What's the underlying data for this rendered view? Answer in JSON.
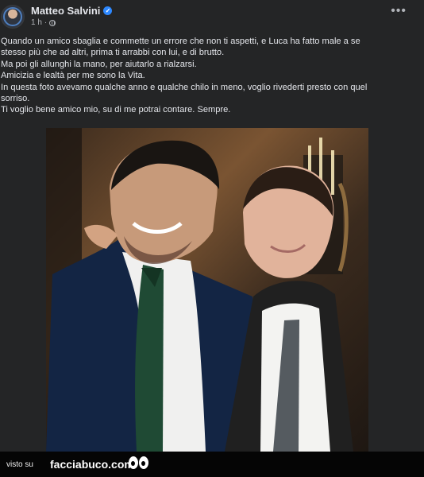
{
  "post": {
    "author": "Matteo Salvini",
    "time": "1 h",
    "more_icon": "more-horizontal-icon",
    "verified_icon": "verified-check-icon",
    "privacy_icon": "globe-icon",
    "lines": [
      "Quando un amico sbaglia e commette un errore che non ti aspetti, e Luca ha fatto male a se",
      "stesso più che ad altri, prima ti arrabbi con lui, e di brutto.",
      "Ma poi gli allunghi la mano, per aiutarlo a rialzarsi.",
      "Amicizia e lealtà per me sono la Vita.",
      "In questa foto avevamo qualche anno e qualche chilo in meno, voglio rivederti presto con quel",
      "sorriso.",
      "Ti voglio bene amico mio, su di me potrai contare. Sempre."
    ]
  },
  "footer": {
    "visto": "visto su",
    "brand": "facciabuco.com"
  },
  "colors": {
    "background": "#18191a",
    "card": "#242526",
    "text": "#e4e6eb",
    "secondary": "#b0b3b8",
    "verified": "#2d88ff"
  }
}
